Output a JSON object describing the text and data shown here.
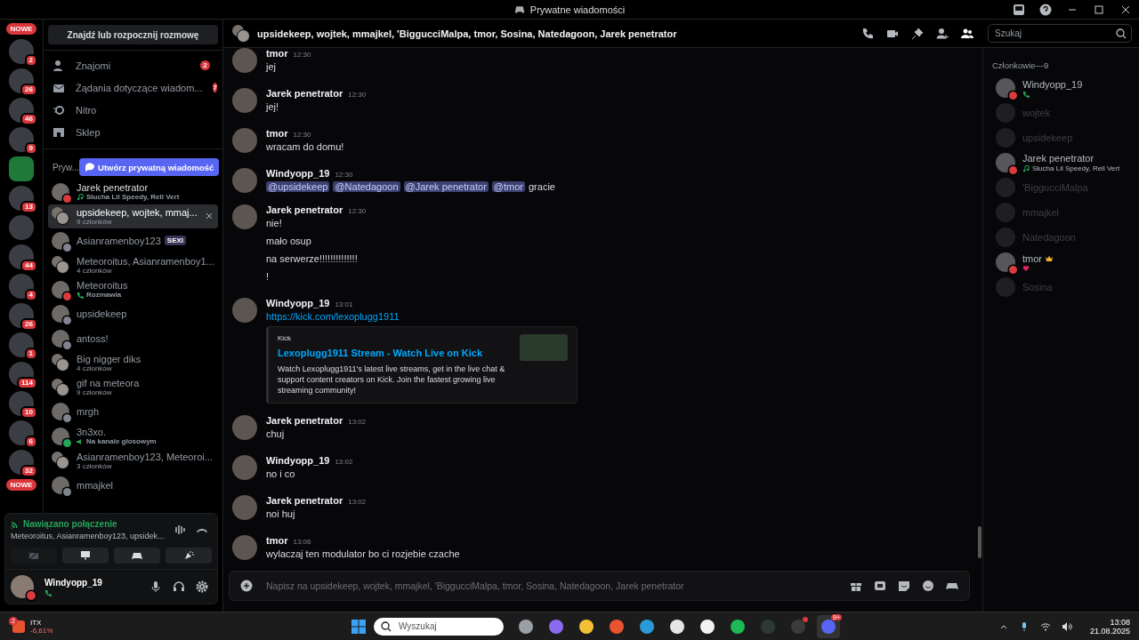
{
  "titlebar": {
    "title": "Prywatne wiadomości"
  },
  "servers": [
    {
      "kind": "pill",
      "label": "NOWE"
    },
    {
      "kind": "server",
      "badge": "2"
    },
    {
      "kind": "server",
      "badge": "26"
    },
    {
      "kind": "server",
      "badge": "46"
    },
    {
      "kind": "server",
      "badge": "9"
    },
    {
      "kind": "logo"
    },
    {
      "kind": "server",
      "badge": "13"
    },
    {
      "kind": "server"
    },
    {
      "kind": "server",
      "badge": "44"
    },
    {
      "kind": "server",
      "badge": "4"
    },
    {
      "kind": "server",
      "badge": "26"
    },
    {
      "kind": "server",
      "badge": "1"
    },
    {
      "kind": "server",
      "badge": "114"
    },
    {
      "kind": "server",
      "badge": "10"
    },
    {
      "kind": "server",
      "badge": "6"
    },
    {
      "kind": "server",
      "badge": "32"
    },
    {
      "kind": "pill",
      "label": "NOWE"
    }
  ],
  "dm_search": {
    "label": "Znajdź lub rozpocznij rozmowę"
  },
  "nav": [
    {
      "kind": "friends",
      "label": "Znajomi",
      "badge": "2"
    },
    {
      "kind": "requests",
      "label": "Żądania dotyczące wiadom...",
      "badge": "7"
    },
    {
      "kind": "nitro",
      "label": "Nitro"
    },
    {
      "kind": "shop",
      "label": "Sklep"
    }
  ],
  "dm_header": {
    "label": "Pryw...",
    "button": "Utwórz prywatną wiadomość"
  },
  "dms": [
    {
      "name": "Jarek penetrator",
      "subtitle": "Słucha Lil Speedy, Rell Vert",
      "kind": "music",
      "color": "#d83c3e",
      "group": false,
      "selected": false
    },
    {
      "name": "upsidekeep, wojtek, mmaj...",
      "subtitle": "9 członków",
      "kind": "plain",
      "group": true,
      "selected": true
    },
    {
      "name": "Asianramenboy123",
      "tag": "SEXI",
      "color": "#80848e",
      "group": false,
      "selected": false
    },
    {
      "name": "Meteoroitus, Asianramenboy1...",
      "subtitle": "4 członków",
      "kind": "plain",
      "group": true,
      "selected": false
    },
    {
      "name": "Meteoroitus",
      "subtitle": "Rozmawia",
      "kind": "call",
      "color": "#d83c3e",
      "group": false,
      "selected": false
    },
    {
      "name": "upsidekeep",
      "color": "#80848e",
      "group": false,
      "selected": false
    },
    {
      "name": "antoss!",
      "color": "#80848e",
      "group": false,
      "selected": false
    },
    {
      "name": "Big nigger diks",
      "subtitle": "4 członków",
      "kind": "plain",
      "group": true,
      "selected": false
    },
    {
      "name": "gif na meteora",
      "subtitle": "9 członków",
      "kind": "plain",
      "group": true,
      "selected": false
    },
    {
      "name": "mrgh",
      "color": "#80848e",
      "group": false,
      "selected": false
    },
    {
      "name": "3n3xo.",
      "subtitle": "Na kanale głosowym",
      "kind": "voice",
      "color": "#23a55a",
      "group": false,
      "selected": false
    },
    {
      "name": "Asianramenboy123, Meteoroi...",
      "subtitle": "3 członków",
      "kind": "plain",
      "group": true,
      "selected": false
    },
    {
      "name": "mmajkel",
      "color": "#80848e",
      "group": false,
      "selected": false
    }
  ],
  "voice": {
    "status": "Nawiązano połączenie",
    "channel": "Meteoroitus, Asianramenboy123, upsidek...",
    "buttons": [
      {
        "kind": "camera",
        "disabled": true
      },
      {
        "kind": "screen",
        "disabled": false
      },
      {
        "kind": "activity",
        "disabled": false
      },
      {
        "kind": "soundboard",
        "disabled": false
      }
    ]
  },
  "user": {
    "name": "Windyopp_19",
    "color": "#d83c3e"
  },
  "chat_header": {
    "title": "upsidekeep, wojtek, mmajkel, 'BiggucciMalpa, tmor, Sosina, Natedagoon, Jarek penetrator",
    "search_placeholder": "Szukaj"
  },
  "messages": [
    {
      "kind": "text",
      "author": "tmor",
      "time": "12:30",
      "lines": [
        "jej"
      ]
    },
    {
      "kind": "text",
      "author": "Jarek penetrator",
      "time": "12:30",
      "lines": [
        "jej!"
      ]
    },
    {
      "kind": "text",
      "author": "tmor",
      "time": "12:30",
      "lines": [
        "wracam do domu!"
      ]
    },
    {
      "kind": "mentions",
      "author": "Windyopp_19",
      "time": "12:30",
      "mentions": [
        "@upsidekeep",
        "@Natedagoon",
        "@Jarek penetrator",
        "@tmor"
      ],
      "text": "gracie"
    },
    {
      "kind": "text",
      "author": "Jarek penetrator",
      "time": "12:30",
      "lines": [
        "nie!",
        "mało osup",
        "na serwerze!!!!!!!!!!!!!!",
        "!"
      ]
    },
    {
      "kind": "link",
      "author": "Windyopp_19",
      "time": "13:01",
      "url": "https://kick.com/lexoplugg1911",
      "embed": {
        "provider": "Kick",
        "title": "Lexoplugg1911 Stream - Watch Live on Kick",
        "description": "Watch Lexoplugg1911's latest live streams, get in the live chat & support content creators on Kick. Join the fastest growing live streaming community!"
      }
    },
    {
      "kind": "text",
      "author": "Jarek penetrator",
      "time": "13:02",
      "lines": [
        "chuj"
      ]
    },
    {
      "kind": "text",
      "author": "Windyopp_19",
      "time": "13:02",
      "lines": [
        "no i co"
      ]
    },
    {
      "kind": "text",
      "author": "Jarek penetrator",
      "time": "13:02",
      "lines": [
        "noi huj"
      ]
    },
    {
      "kind": "text",
      "author": "tmor",
      "time": "13:06",
      "lines": [
        "wylaczaj ten modulator bo ci rozjebie czache"
      ]
    }
  ],
  "composer": {
    "placeholder": "Napisz na upsidekeep, wojtek, mmajkel, 'BiggucciMalpa, tmor, Sosina, Natedagoon, Jarek penetrator"
  },
  "members": {
    "title": "Członkowie—9",
    "list": [
      {
        "name": "Windyopp_19",
        "offline": false,
        "color": "#d83c3e",
        "kind": "call",
        "owner": false
      },
      {
        "name": "wojtek",
        "offline": true,
        "kind": "plain",
        "owner": false
      },
      {
        "name": "upsidekeep",
        "offline": true,
        "kind": "plain",
        "owner": false
      },
      {
        "name": "Jarek penetrator",
        "offline": false,
        "color": "#d83c3e",
        "kind": "music",
        "activity_text": "Słucha Lil Speedy, Rell Vert",
        "owner": false
      },
      {
        "name": "'BiggucciMalpa",
        "offline": true,
        "kind": "plain",
        "owner": false
      },
      {
        "name": "mmajkel",
        "offline": true,
        "kind": "plain",
        "owner": false
      },
      {
        "name": "Natedagoon",
        "offline": true,
        "kind": "plain",
        "owner": false
      },
      {
        "name": "tmor",
        "offline": false,
        "color": "#d83c3e",
        "kind": "emoji",
        "owner": true
      },
      {
        "name": "Sosina",
        "offline": true,
        "kind": "plain",
        "owner": false
      }
    ]
  },
  "taskbar": {
    "ticker": {
      "name": "ITX",
      "change": "-6,61%",
      "badge": "2"
    },
    "search_placeholder": "Wyszukaj",
    "apps": [
      {
        "kind": "taskview",
        "active": false
      },
      {
        "kind": "copilot",
        "active": false
      },
      {
        "kind": "files",
        "active": false
      },
      {
        "kind": "brave",
        "active": false
      },
      {
        "kind": "edge",
        "active": false
      },
      {
        "kind": "store",
        "active": false
      },
      {
        "kind": "file",
        "active": false
      },
      {
        "kind": "spotify",
        "active": false
      },
      {
        "kind": "terminal",
        "active": false
      },
      {
        "kind": "obs",
        "active": false,
        "dot": true
      },
      {
        "kind": "discord",
        "active": true,
        "badge": "9+"
      }
    ],
    "time": "13:08",
    "date": "21.08.2025"
  }
}
